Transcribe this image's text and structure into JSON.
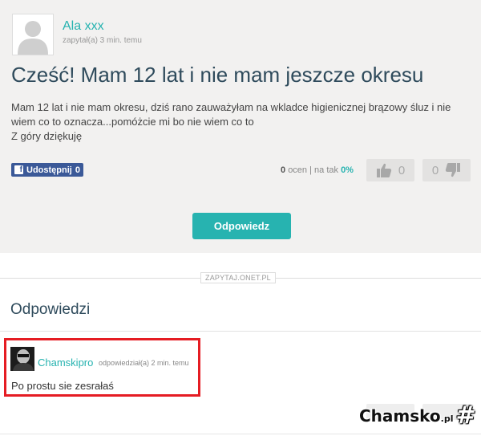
{
  "question": {
    "author": "Ala xxx",
    "asked_meta": "zapytał(a) 3 min. temu",
    "title": "Cześć! Mam 12 lat i nie mam jeszcze okresu",
    "body_lines": [
      "Mam 12 lat i nie mam okresu, dziś rano zauważyłam na wkladce higienicznej brązowy śluz i nie",
      "wiem co to oznacza...pomóżcie mi bo nie wiem co to",
      "Z góry dziękuję"
    ],
    "share": {
      "label": "Udostępnij",
      "count": "0"
    },
    "stats": {
      "ratings_count": "0",
      "ratings_label": "ocen",
      "separator": "|",
      "yes_label": "na tak",
      "yes_percent": "0%"
    },
    "upvotes": "0",
    "downvotes": "0",
    "answer_button": "Odpowiedz"
  },
  "source_tag": "ZAPYTAJ.ONET.PL",
  "answers": {
    "heading": "Odpowiedzi",
    "items": [
      {
        "author": "Chamskipro",
        "meta": "odpowiedział(a) 2 min. temu",
        "text": "Po prostu sie zesrałaś"
      }
    ]
  },
  "watermark": {
    "main": "Chamsko",
    "suffix": ".pl",
    "symbol": "#"
  },
  "colors": {
    "accent": "#27b3b0",
    "title": "#2f4b5c",
    "facebook": "#3b5998",
    "highlight": "#e51c23",
    "panel": "#f2f1f0"
  },
  "icons": {
    "avatar": "user-silhouette-icon",
    "upvote": "thumbs-up-icon",
    "downvote": "thumbs-down-icon",
    "share": "facebook-icon"
  }
}
